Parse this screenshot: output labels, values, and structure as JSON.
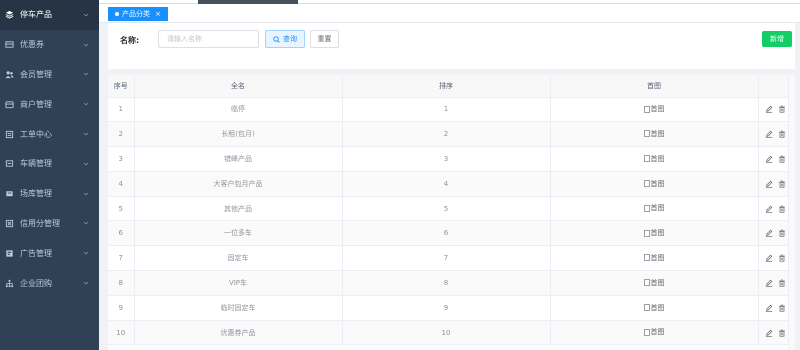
{
  "sidebar": {
    "items": [
      {
        "label": "停车产品",
        "icon": "layers-icon",
        "active": true
      },
      {
        "label": "优惠券",
        "icon": "coupon-icon",
        "active": false
      },
      {
        "label": "会员管理",
        "icon": "users-icon",
        "active": false
      },
      {
        "label": "商户管理",
        "icon": "shop-icon",
        "active": false
      },
      {
        "label": "工单中心",
        "icon": "ticket-icon",
        "active": false
      },
      {
        "label": "车辆管理",
        "icon": "car-icon",
        "active": false
      },
      {
        "label": "场库管理",
        "icon": "warehouse-icon",
        "active": false
      },
      {
        "label": "信用分管理",
        "icon": "credit-icon",
        "active": false
      },
      {
        "label": "广告管理",
        "icon": "ad-icon",
        "active": false
      },
      {
        "label": "企业团购",
        "icon": "org-tree-icon",
        "active": false
      }
    ]
  },
  "tags": {
    "active_label": "产品分类",
    "close": "×"
  },
  "search": {
    "label": "名称:",
    "placeholder": "请输入名称",
    "search_button": "查询",
    "reset_button": "重置",
    "add_button": "新增"
  },
  "table": {
    "headers": [
      "序号",
      "全名",
      "排序",
      "首图",
      "操作"
    ],
    "image_alt": "首图",
    "rows": [
      {
        "index": "1",
        "name": "临停",
        "sort": "1"
      },
      {
        "index": "2",
        "name": "长租(包月)",
        "sort": "2"
      },
      {
        "index": "3",
        "name": "错峰产品",
        "sort": "3"
      },
      {
        "index": "4",
        "name": "大客户包月产品",
        "sort": "4"
      },
      {
        "index": "5",
        "name": "其他产品",
        "sort": "5"
      },
      {
        "index": "6",
        "name": "一位多车",
        "sort": "6"
      },
      {
        "index": "7",
        "name": "固定车",
        "sort": "7"
      },
      {
        "index": "8",
        "name": "VIP车",
        "sort": "8"
      },
      {
        "index": "9",
        "name": "临时固定车",
        "sort": "9"
      },
      {
        "index": "10",
        "name": "优惠券产品",
        "sort": "10"
      }
    ]
  },
  "colors": {
    "sidebar_bg": "#304156",
    "primary": "#1890ff",
    "success": "#13ce66"
  }
}
